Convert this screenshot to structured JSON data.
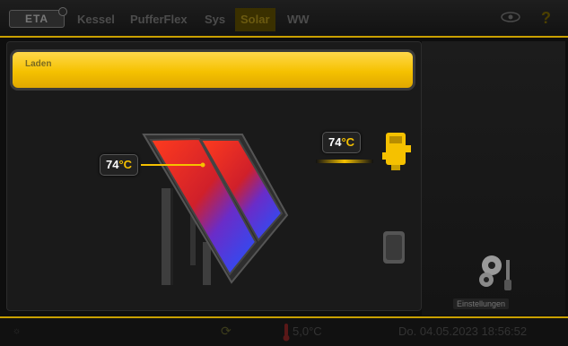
{
  "app": {
    "logo_text": "ETA"
  },
  "tabs": [
    "Kessel",
    "PufferFlex",
    "Sys",
    "Solar",
    "WW"
  ],
  "active_tab": "Solar",
  "status_bar": {
    "text": "Laden"
  },
  "collector": {
    "temperature": "74",
    "unit": "°C"
  },
  "consumer": {
    "temperature": "74",
    "unit": "°C"
  },
  "sidebar": {
    "settings_label": "Einstellungen"
  },
  "bottom": {
    "outdoor_temp": "5,0°C",
    "datetime": "Do. 04.05.2023 18:56:52"
  },
  "colors": {
    "accent": "#f5c100",
    "background": "#0e0e0e"
  },
  "icons": [
    "eye-icon",
    "help-icon",
    "gear-icon",
    "thermometer-icon",
    "sun-icon"
  ]
}
